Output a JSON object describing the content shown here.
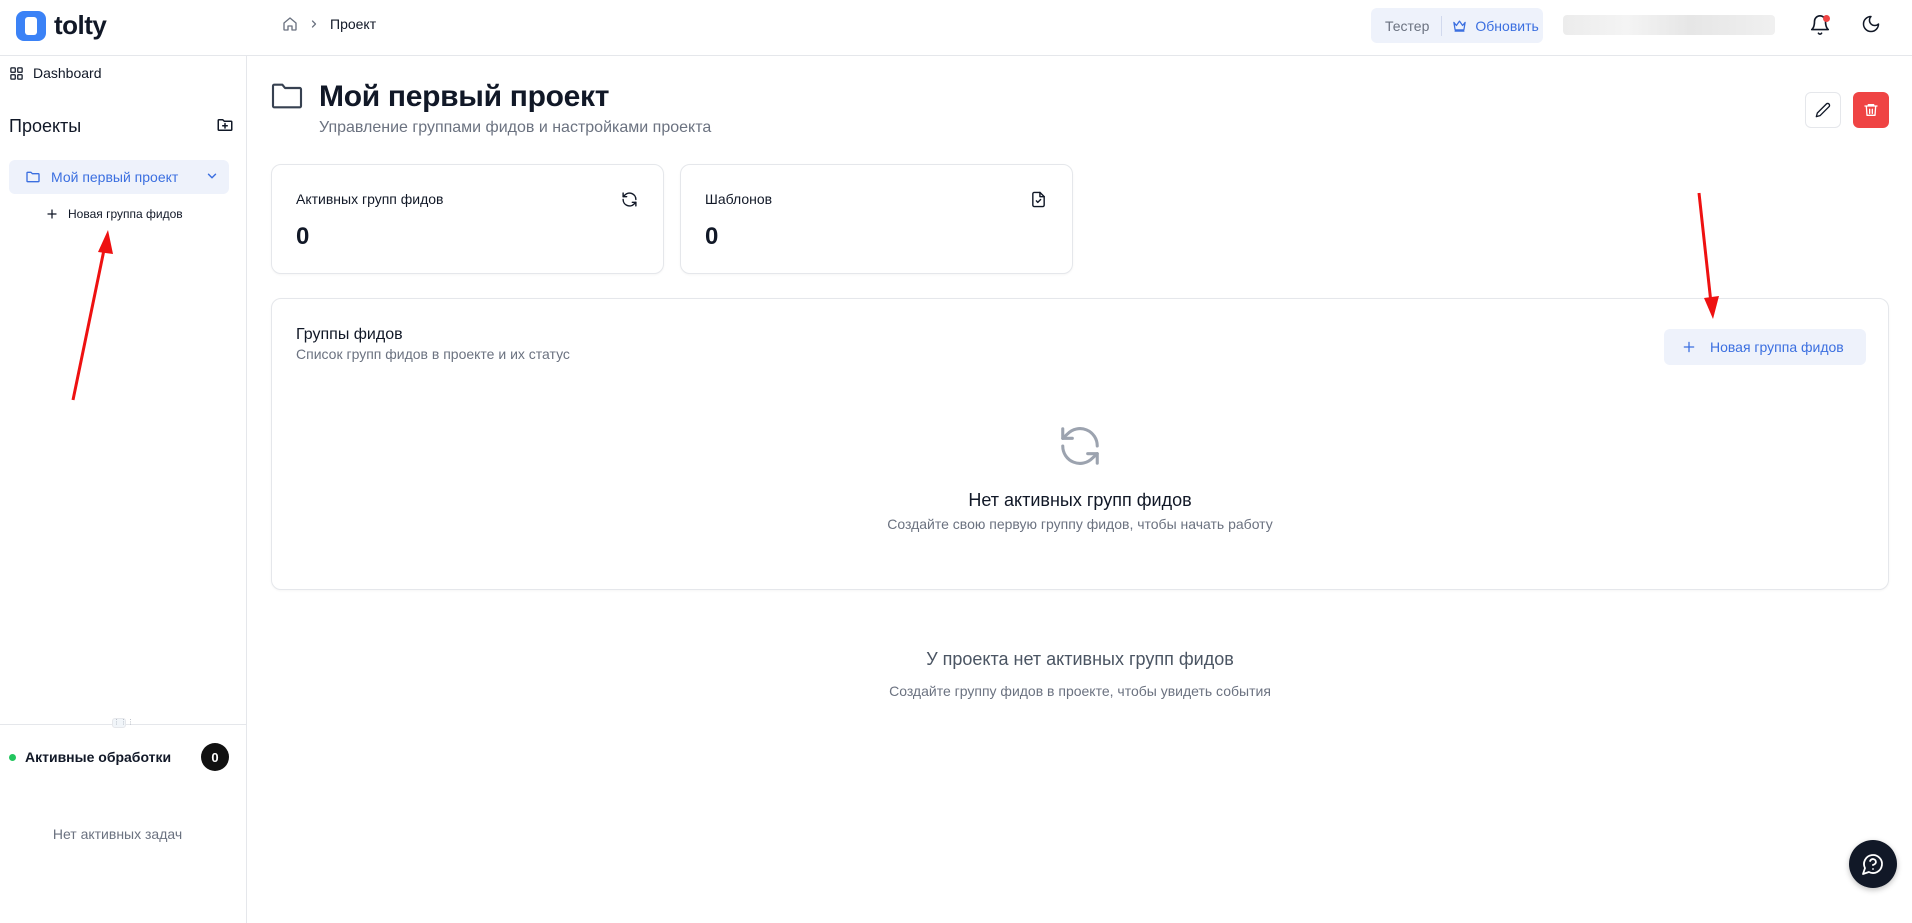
{
  "app": {
    "logo_text": "tolty"
  },
  "breadcrumb": {
    "current": "Проект"
  },
  "header": {
    "plan_label": "Тестер",
    "upgrade_label": "Обновить"
  },
  "sidebar": {
    "dashboard_label": "Dashboard",
    "projects_title": "Проекты",
    "project_name": "Мой первый проект",
    "new_group_label": "Новая группа фидов",
    "active_processing_label": "Активные обработки",
    "active_processing_count": "0",
    "no_tasks_text": "Нет активных задач"
  },
  "page": {
    "title": "Мой первый проект",
    "subtitle": "Управление группами фидов и настройками проекта"
  },
  "stats": [
    {
      "label": "Активных групп фидов",
      "value": "0",
      "icon": "refresh-icon"
    },
    {
      "label": "Шаблонов",
      "value": "0",
      "icon": "file-template-icon"
    }
  ],
  "feed_groups": {
    "title": "Группы фидов",
    "subtitle": "Список групп фидов в проекте и их статус",
    "new_button_label": "Новая группа фидов",
    "empty_title": "Нет активных групп фидов",
    "empty_subtitle": "Создайте свою первую группу фидов, чтобы начать работу"
  },
  "events": {
    "empty_title": "У проекта нет активных групп фидов",
    "empty_subtitle": "Создайте группу фидов в проекте, чтобы увидеть события"
  },
  "colors": {
    "accent": "#3b6fe0",
    "accent_bg": "#eef2fb",
    "danger": "#ef4444",
    "status_active": "#22c55e",
    "annotation_arrow": "#ee1111"
  }
}
